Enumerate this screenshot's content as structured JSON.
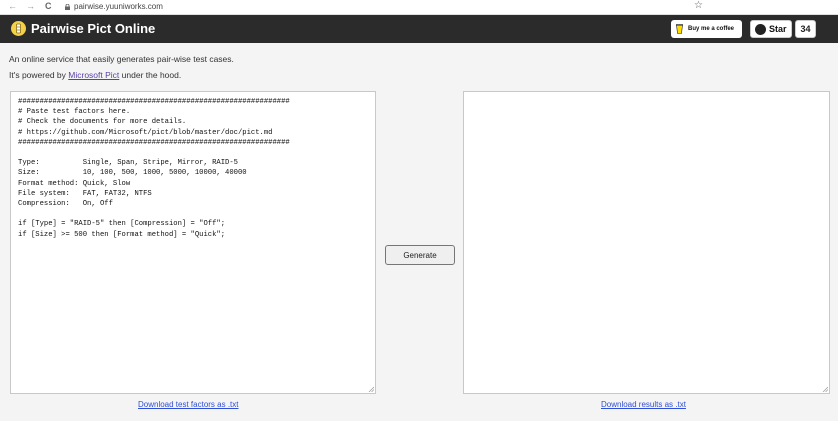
{
  "browser": {
    "url": "pairwise.yuuniworks.com",
    "back_glyph": "←",
    "forward_glyph": "→",
    "reload_glyph": "C",
    "bookmark_glyph": "☆"
  },
  "header": {
    "title": "Pairwise Pict Online",
    "coffee_label": "Buy me a coffee",
    "star_label": "Star",
    "star_count": "34",
    "bg_color": "#2b2b2b",
    "logo_color": "#f5d14a"
  },
  "intro": {
    "line1": "An online service that easily generates pair-wise test cases.",
    "line2_prefix": "It's powered by",
    "line2_link": "Microsoft Pict",
    "line2_suffix": " under the hood."
  },
  "factors": {
    "text": "###############################################################\n# Paste test factors here.\n# Check the documents for more details.\n# https://github.com/Microsoft/pict/blob/master/doc/pict.md\n###############################################################\n\nType:          Single, Span, Stripe, Mirror, RAID-5\nSize:          10, 100, 500, 1000, 5000, 10000, 40000\nFormat method: Quick, Slow\nFile system:   FAT, FAT32, NTFS\nCompression:   On, Off\n\nif [Type] = \"RAID-5\" then [Compression] = \"Off\";\nif [Size] >= 500 then [Format method] = \"Quick\";"
  },
  "results": {
    "text": ""
  },
  "actions": {
    "generate_label": "Generate",
    "download_factors_label": "Download test factors as .txt",
    "download_results_label": "Download results as .txt"
  }
}
